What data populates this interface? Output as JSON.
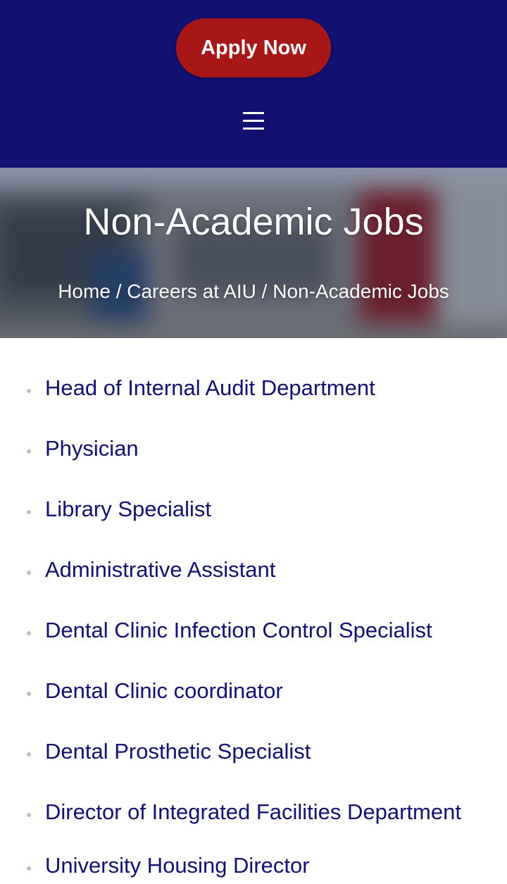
{
  "header": {
    "apply_label": "Apply Now",
    "menu_icon": "hamburger-menu-icon",
    "background_color": "#121070",
    "button_color": "#a81717"
  },
  "hero": {
    "title": "Non-Academic Jobs",
    "breadcrumb": {
      "home": "Home",
      "separator": "/",
      "careers": "Careers at AIU",
      "current": "Non-Academic Jobs"
    }
  },
  "jobs": [
    "Head of Internal Audit Department",
    "Physician",
    "Library Specialist",
    "Administrative Assistant",
    "Dental Clinic Infection Control Specialist",
    "Dental Clinic coordinator",
    "Dental Prosthetic Specialist",
    "Director of Integrated Facilities Department",
    "University Housing Director"
  ],
  "colors": {
    "link_text": "#121070",
    "bullet": "#bfbfbf"
  }
}
